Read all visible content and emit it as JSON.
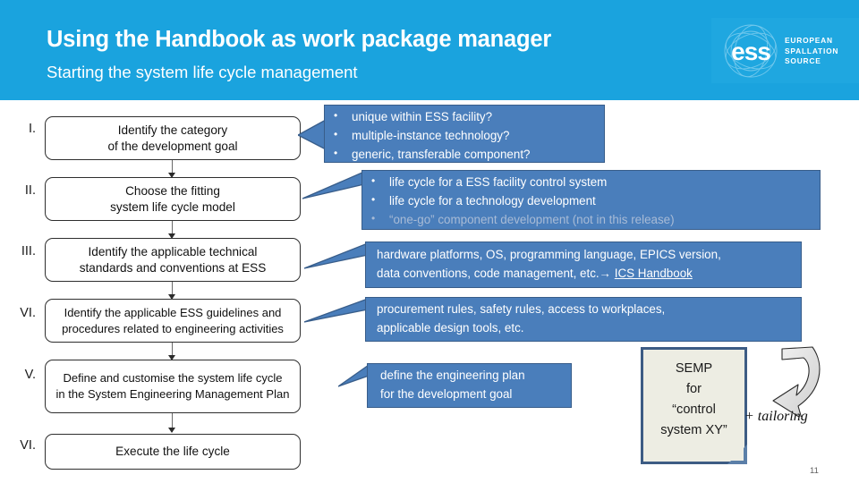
{
  "header": {
    "title": "Using the Handbook as work package manager",
    "subtitle": "Starting the system life cycle management",
    "band_color": "#1AA3DE",
    "logo": {
      "name": "ess-logo",
      "wordmark": "ess",
      "line1": "EUROPEAN",
      "line2": "SPALLATION",
      "line3": "SOURCE"
    }
  },
  "flow": {
    "accent_color": "#4A7EBB",
    "steps": [
      {
        "numeral": "I.",
        "line1": "Identify the category",
        "line2": "of the development goal"
      },
      {
        "numeral": "II.",
        "line1": "Choose the fitting",
        "line2": "system life cycle model"
      },
      {
        "numeral": "III.",
        "line1": "Identify the applicable technical",
        "line2": "standards and conventions at ESS"
      },
      {
        "numeral": "VI.",
        "line1": "Identify the applicable ESS guidelines and",
        "line2": "procedures related to engineering activities"
      },
      {
        "numeral": "V.",
        "line1": "Define and customise the system life cycle",
        "line2": "in the System Engineering Management Plan"
      },
      {
        "numeral": "VI.",
        "line1": "Execute the life cycle",
        "line2": ""
      }
    ]
  },
  "callouts": {
    "one": {
      "bullets": [
        {
          "text": "unique within ESS facility?",
          "dim": false
        },
        {
          "text": "multiple-instance technology?",
          "dim": false
        },
        {
          "text": "generic, transferable component?",
          "dim": false
        }
      ]
    },
    "two": {
      "bullets": [
        {
          "text": "life cycle for a ESS facility control system",
          "dim": false
        },
        {
          "text": "life cycle for a technology development",
          "dim": false
        },
        {
          "text": "“one-go” component development (not in this release)",
          "dim": true
        }
      ]
    },
    "three": {
      "line1": "hardware platforms, OS, programming language, EPICS version,",
      "line2_prefix": "data conventions, code management, etc.→ ",
      "link": "ICS Handbook"
    },
    "four": {
      "line1": "procurement rules, safety rules, access to workplaces,",
      "line2": "applicable design tools, etc."
    },
    "five": {
      "line1": "define the engineering plan",
      "line2": "for the development goal"
    }
  },
  "semp": {
    "line1": "SEMP",
    "line2": "for",
    "line3": "“control",
    "line4": "system XY”",
    "annotation": "+ tailoring"
  },
  "footer": {
    "page_number": "11"
  }
}
